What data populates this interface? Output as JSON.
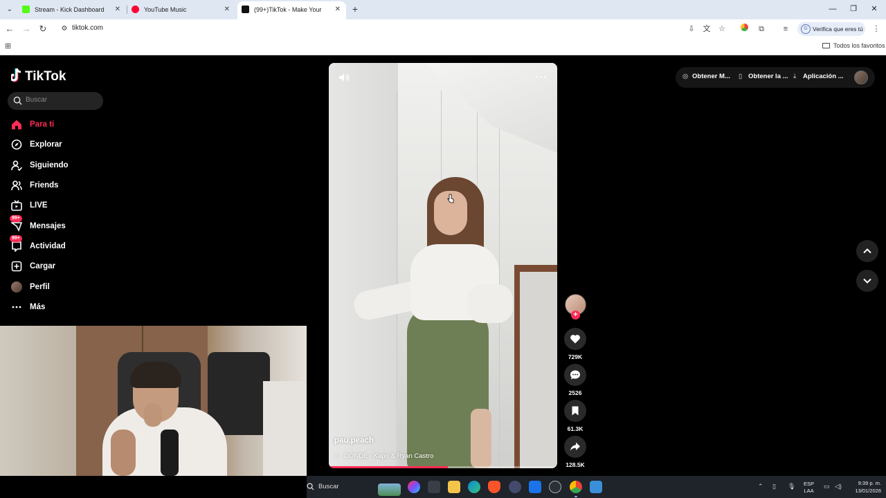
{
  "browser": {
    "tabs": [
      {
        "title": "Stream - Kick Dashboard",
        "favicon_color": "#53fc18",
        "active": false
      },
      {
        "title": "YouTube Music",
        "favicon_color": "#ff0033",
        "active": false
      },
      {
        "title": "(99+)TikTok - Make Your Da",
        "favicon_color": "#111111",
        "active": true
      }
    ],
    "url": "tiktok.com",
    "verify_label": "Verifica que eres tú",
    "all_favorites": "Todos los favoritos"
  },
  "sidebar": {
    "logo": "TikTok",
    "search_placeholder": "Buscar",
    "items": [
      {
        "label": "Para ti",
        "icon": "home-icon",
        "active": true
      },
      {
        "label": "Explorar",
        "icon": "compass-icon"
      },
      {
        "label": "Siguiendo",
        "icon": "following-icon"
      },
      {
        "label": "Friends",
        "icon": "friends-icon"
      },
      {
        "label": "LIVE",
        "icon": "live-tv-icon"
      },
      {
        "label": "Mensajes",
        "icon": "messages-icon",
        "badge": "99+"
      },
      {
        "label": "Actividad",
        "icon": "activity-icon",
        "badge": "99+"
      },
      {
        "label": "Cargar",
        "icon": "upload-icon"
      },
      {
        "label": "Perfil",
        "icon": "profile-avatar"
      },
      {
        "label": "Más",
        "icon": "more-icon"
      }
    ]
  },
  "video": {
    "author": "pau.peach",
    "music": "DÓNDE - Kapo & Ryan Castro",
    "progress": 0.52,
    "likes": "729K",
    "comments": "2526",
    "saves": "61.3K",
    "shares": "128.5K"
  },
  "header": {
    "items": [
      {
        "label": "Obtener M...",
        "icon": "coin-icon"
      },
      {
        "label": "Obtener la ...",
        "icon": "phone-icon"
      },
      {
        "label": "Aplicación ...",
        "icon": "download-icon"
      }
    ]
  },
  "taskbar": {
    "search": "Buscar",
    "lang_1": "ESP",
    "lang_2": "LAA",
    "time": "9:39 p. m.",
    "date": "13/01/2026"
  },
  "colors": {
    "accent": "#fe2c55",
    "page_bg": "#000000",
    "chrome_bg": "#dfe7f3"
  }
}
